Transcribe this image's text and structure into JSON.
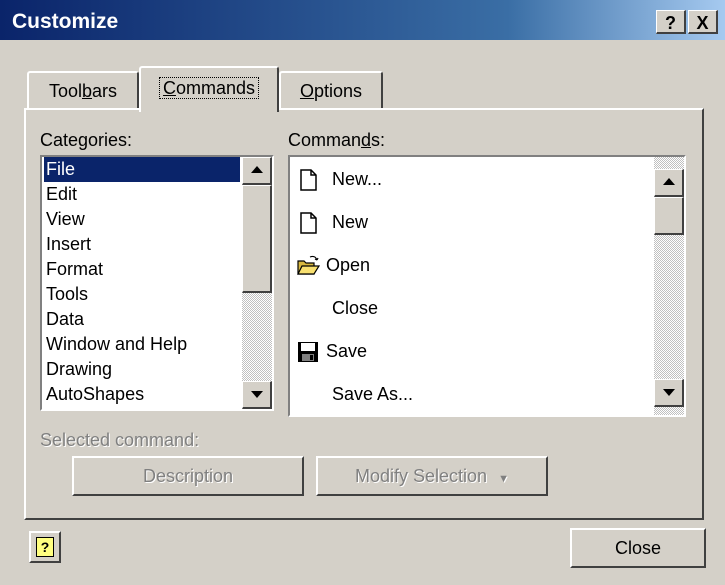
{
  "window": {
    "title": "Customize",
    "help_btn": "?",
    "close_btn": "X"
  },
  "tabs": [
    {
      "pre": "Tool",
      "key": "b",
      "post": "ars",
      "active": false
    },
    {
      "pre": "",
      "key": "C",
      "post": "ommands",
      "active": true
    },
    {
      "pre": "",
      "key": "O",
      "post": "ptions",
      "active": false
    }
  ],
  "categories": {
    "label_pre": "Cate",
    "label_key": "g",
    "label_post": "ories:",
    "items": [
      "File",
      "Edit",
      "View",
      "Insert",
      "Format",
      "Tools",
      "Data",
      "Window and Help",
      "Drawing",
      "AutoShapes"
    ],
    "selected_index": 0
  },
  "commands": {
    "label_pre": "Comman",
    "label_key": "d",
    "label_post": "s:",
    "items": [
      {
        "label": "New...",
        "icon": "new-document-icon"
      },
      {
        "label": "New",
        "icon": "new-document-icon"
      },
      {
        "label": "Open",
        "icon": "open-folder-icon"
      },
      {
        "label": "Close",
        "icon": ""
      },
      {
        "label": "Save",
        "icon": "save-disk-icon"
      },
      {
        "label": "Save As...",
        "icon": ""
      }
    ]
  },
  "selected_command": {
    "label": "Selected command:",
    "description_button": "Description",
    "modify_button": "Modify Selection",
    "modify_arrow": "▼"
  },
  "footer": {
    "help_icon": "?",
    "close_button": "Close"
  },
  "colors": {
    "selection": "#0a246a",
    "dialog_face": "#d4d0c8",
    "title_gradient_start": "#0a246a",
    "title_gradient_end": "#a6caf0"
  }
}
